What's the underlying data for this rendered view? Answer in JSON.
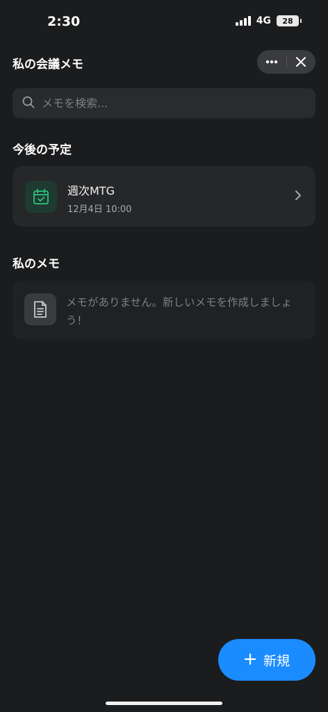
{
  "status_bar": {
    "time": "2:30",
    "network": "4G",
    "battery": "28"
  },
  "header": {
    "title": "私の会議メモ"
  },
  "search": {
    "placeholder": "メモを検索..."
  },
  "upcoming": {
    "title": "今後の予定",
    "event": {
      "name": "週次MTG",
      "datetime": "12月4日 10:00"
    }
  },
  "memos": {
    "title": "私のメモ",
    "empty_message": "メモがありません。新しいメモを作成しましょう！"
  },
  "fab": {
    "icon": "+",
    "label": "新規"
  },
  "colors": {
    "background": "#1b1c1e",
    "accent": "#1a8cff",
    "calendar_green": "#2bb673"
  }
}
